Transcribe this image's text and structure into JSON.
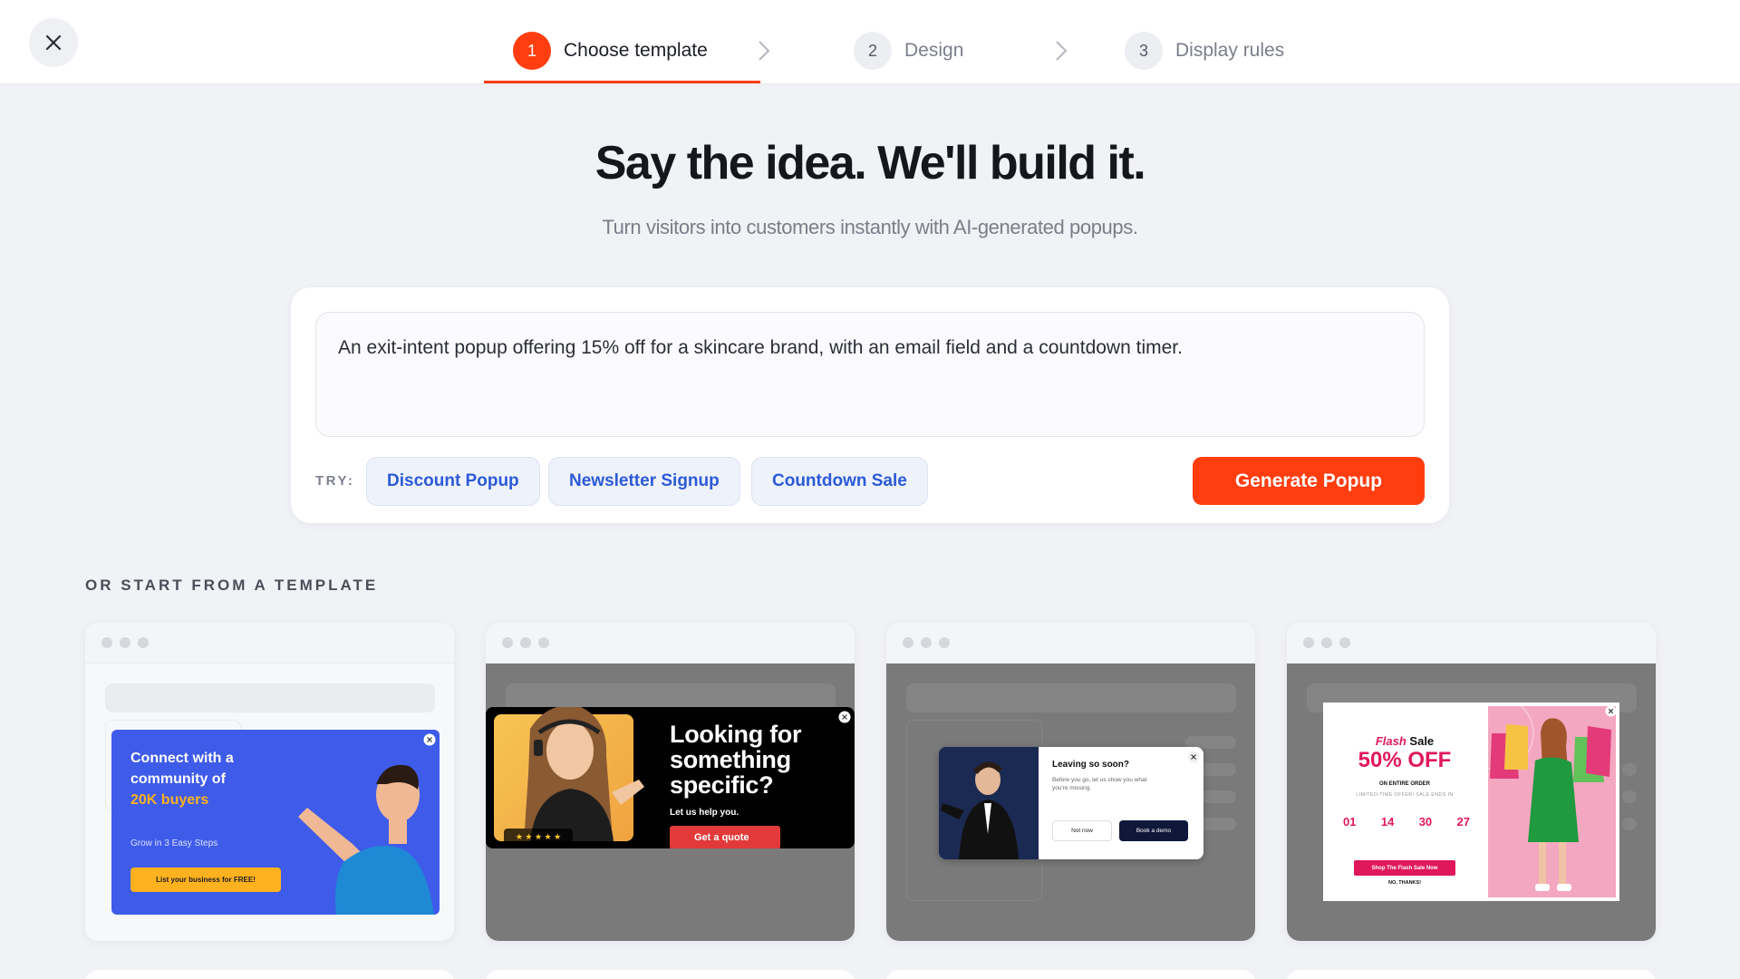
{
  "header": {
    "steps": [
      {
        "num": "1",
        "label": "Choose template"
      },
      {
        "num": "2",
        "label": "Design"
      },
      {
        "num": "3",
        "label": "Display rules"
      }
    ]
  },
  "hero": {
    "title": "Say the idea. We'll build it.",
    "subtitle": "Turn visitors into customers instantly with AI-generated popups."
  },
  "prompt": {
    "value": "An exit-intent popup offering 15% off for a skincare brand, with an email field and a countdown timer.",
    "try_label": "TRY:",
    "chips": [
      "Discount Popup",
      "Newsletter Signup",
      "Countdown Sale"
    ],
    "generate_label": "Generate Popup"
  },
  "templates": {
    "section_label": "OR START FROM A TEMPLATE",
    "t1": {
      "line1": "Connect with a",
      "line2": "community of",
      "highlight": "20K buyers",
      "steps": "Grow in 3 Easy Steps",
      "cta": "List your business for FREE!"
    },
    "t2": {
      "headline1": "Looking for",
      "headline2": "something",
      "headline3": "specific?",
      "sub": "Let us help you.",
      "cta": "Get a quote",
      "stars": "★ ★ ★ ★ ★"
    },
    "t3": {
      "title": "Leaving so soon?",
      "body": "Before you go, let us show you what you're missing.",
      "secondary": "Not now",
      "primary": "Book a demo"
    },
    "t4": {
      "flash": "Flash",
      "sale": "Sale",
      "discount": "50% OFF",
      "entire": "ON ENTIRE ORDER",
      "limited": "LIMITED-TIME OFFER! SALE ENDS IN",
      "timer": [
        "01",
        "14",
        "30",
        "27"
      ],
      "cta": "Shop The Flash Sale Now",
      "decline": "NO, THANKS!"
    }
  },
  "colors": {
    "accent": "#ff3d0f",
    "chip_text": "#2c5ad6",
    "t1_bg": "#3f5bea",
    "t1_highlight": "#ffb21f",
    "t2_cta": "#e23a3a",
    "t3_primary": "#10183a",
    "t4_pink": "#e0185b"
  }
}
